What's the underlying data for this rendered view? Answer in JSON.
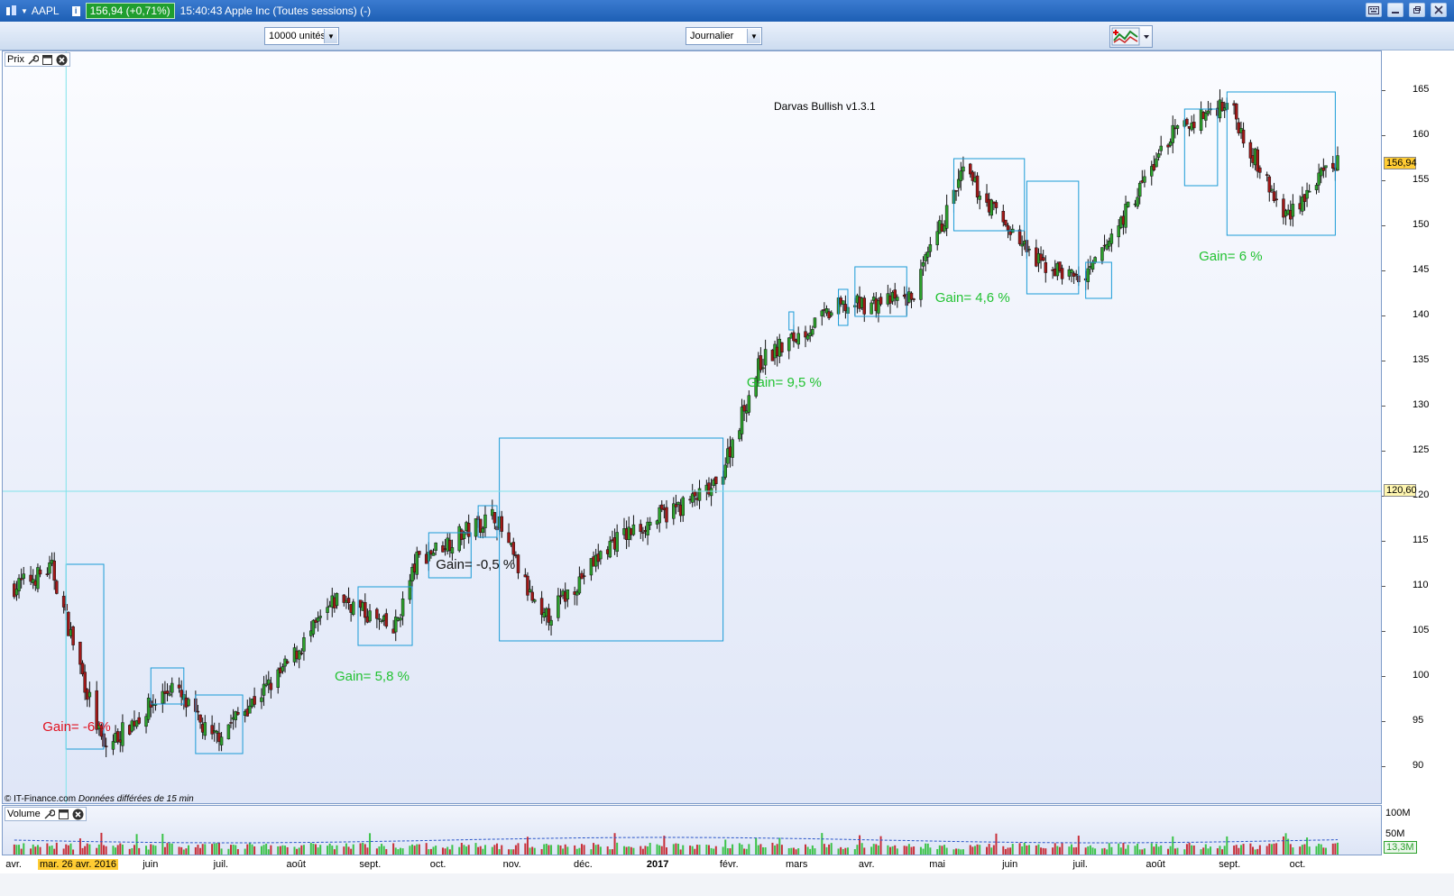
{
  "titlebar": {
    "symbol": "AAPL",
    "info_icon": "info-icon",
    "price_badge": "156,94 (+0,71%)",
    "time_and_name": "15:40:43 Apple Inc (Toutes sessions) (-)",
    "colors": {
      "bar": "#2a6fcc",
      "badge": "#1f9e2f"
    }
  },
  "toolbar": {
    "quantity_select": "10000 unités",
    "period_select": "Journalier",
    "chart_type_icon": "chart-type-icon"
  },
  "price_panel": {
    "tag": "Prix",
    "study_title": "Darvas Bullish v1.3.1",
    "credit": "© IT-Finance.com",
    "credit_note": "Données différées de 15 min",
    "crosshair_price": "120,60",
    "last_price": "156,94",
    "y_ticks": [
      "165",
      "160",
      "155",
      "150",
      "145",
      "140",
      "135",
      "130",
      "125",
      "120",
      "115",
      "110",
      "105",
      "100",
      "95",
      "90"
    ],
    "gains": [
      {
        "text": "Gain= -6 %",
        "tone": "neg"
      },
      {
        "text": "Gain= 5,8 %",
        "tone": "pos"
      },
      {
        "text": "Gain= -0,5 %",
        "tone": "neu"
      },
      {
        "text": "Gain= 9,5 %",
        "tone": "pos"
      },
      {
        "text": "Gain= 4,6 %",
        "tone": "pos"
      },
      {
        "text": "Gain= 6 %",
        "tone": "pos"
      }
    ],
    "colors": {
      "up": "#2ca02c",
      "down": "#a01818",
      "box": "#1a9bd7",
      "crosshair": "#7fe3ea"
    }
  },
  "volume_panel": {
    "tag": "Volume",
    "y_ticks": [
      "100M",
      "50M"
    ],
    "last_volume": "13,3M"
  },
  "date_axis": {
    "crosshair_date": "mar. 26 avr. 2016",
    "months": [
      "avr.",
      "juin",
      "juil.",
      "août",
      "sept.",
      "oct.",
      "nov.",
      "déc.",
      "2017",
      "févr.",
      "mars",
      "avr.",
      "mai",
      "juin",
      "juil.",
      "août",
      "sept.",
      "oct."
    ]
  },
  "chart_data": {
    "type": "candlestick",
    "title": "Darvas Bullish v1.3.1",
    "ylim": [
      88,
      168
    ],
    "x_range": [
      "2016-04",
      "2017-10"
    ],
    "month_labels": [
      "avr.",
      "juin",
      "juil.",
      "août",
      "sept.",
      "oct.",
      "nov.",
      "déc.",
      "2017",
      "févr.",
      "mars",
      "avr.",
      "mai",
      "juin",
      "juil.",
      "août",
      "sept.",
      "oct."
    ],
    "price_trend": [
      {
        "date": "2016-04-04",
        "close": 110
      },
      {
        "date": "2016-04-20",
        "close": 112
      },
      {
        "date": "2016-05-12",
        "close": 92
      },
      {
        "date": "2016-06-10",
        "close": 99
      },
      {
        "date": "2016-06-27",
        "close": 93
      },
      {
        "date": "2016-07-25",
        "close": 100
      },
      {
        "date": "2016-08-20",
        "close": 109
      },
      {
        "date": "2016-09-12",
        "close": 105
      },
      {
        "date": "2016-09-22",
        "close": 113
      },
      {
        "date": "2016-10-25",
        "close": 118
      },
      {
        "date": "2016-11-14",
        "close": 106
      },
      {
        "date": "2016-12-14",
        "close": 115
      },
      {
        "date": "2017-01-27",
        "close": 121
      },
      {
        "date": "2017-02-15",
        "close": 135
      },
      {
        "date": "2017-03-20",
        "close": 141
      },
      {
        "date": "2017-04-20",
        "close": 142
      },
      {
        "date": "2017-05-12",
        "close": 156
      },
      {
        "date": "2017-06-12",
        "close": 146
      },
      {
        "date": "2017-07-03",
        "close": 144
      },
      {
        "date": "2017-08-08",
        "close": 160
      },
      {
        "date": "2017-09-01",
        "close": 164
      },
      {
        "date": "2017-09-25",
        "close": 151
      },
      {
        "date": "2017-10-17",
        "close": 156.94
      }
    ],
    "darvas_boxes": [
      {
        "start": "2016-04-26",
        "end": "2016-05-12",
        "low": 92,
        "high": 112.5
      },
      {
        "start": "2016-06-01",
        "end": "2016-06-15",
        "low": 97,
        "high": 101
      },
      {
        "start": "2016-06-20",
        "end": "2016-07-10",
        "low": 91.5,
        "high": 98
      },
      {
        "start": "2016-08-28",
        "end": "2016-09-20",
        "low": 103.5,
        "high": 110
      },
      {
        "start": "2016-09-27",
        "end": "2016-10-15",
        "low": 111,
        "high": 116
      },
      {
        "start": "2016-10-18",
        "end": "2016-10-26",
        "low": 115.5,
        "high": 119
      },
      {
        "start": "2016-10-27",
        "end": "2017-01-30",
        "low": 104,
        "high": 126.5
      },
      {
        "start": "2017-02-27",
        "end": "2017-03-01",
        "low": 138.5,
        "high": 140.5
      },
      {
        "start": "2017-03-20",
        "end": "2017-03-24",
        "low": 139,
        "high": 143
      },
      {
        "start": "2017-03-27",
        "end": "2017-04-18",
        "low": 140,
        "high": 145.5
      },
      {
        "start": "2017-05-08",
        "end": "2017-06-07",
        "low": 149.5,
        "high": 157.5
      },
      {
        "start": "2017-06-08",
        "end": "2017-06-30",
        "low": 142.5,
        "high": 155
      },
      {
        "start": "2017-07-03",
        "end": "2017-07-14",
        "low": 142,
        "high": 146
      },
      {
        "start": "2017-08-14",
        "end": "2017-08-28",
        "low": 154.5,
        "high": 163
      },
      {
        "start": "2017-09-01",
        "end": "2017-10-17",
        "low": 149,
        "high": 164.9
      }
    ]
  }
}
